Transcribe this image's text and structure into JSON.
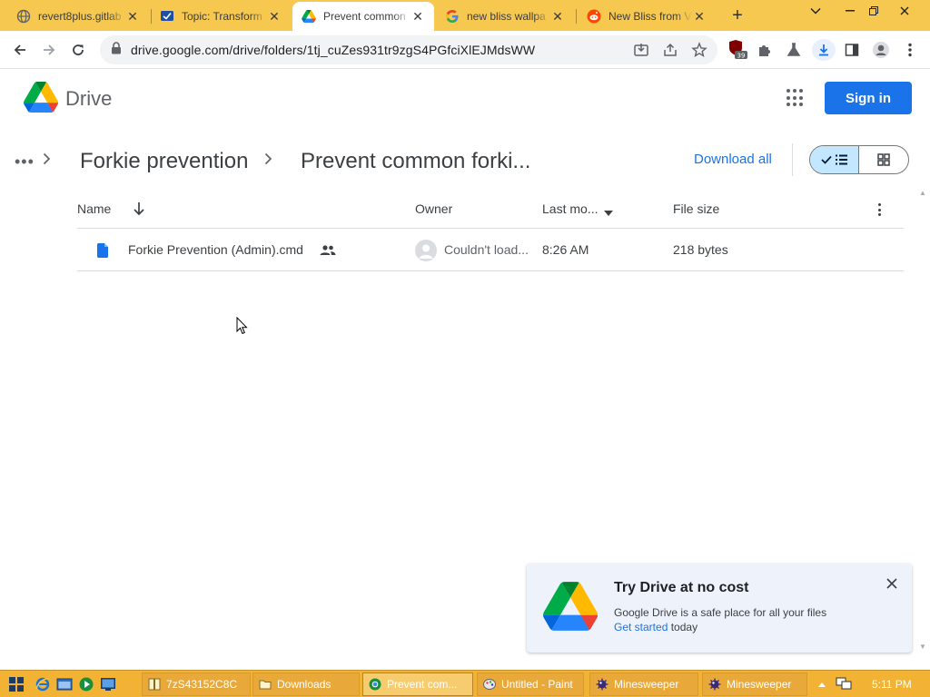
{
  "browser": {
    "tabs": [
      {
        "title": "revert8plus.gitlab",
        "icon": "globe-icon"
      },
      {
        "title": "Topic: Transform",
        "icon": "forum-icon"
      },
      {
        "title": "Prevent common",
        "icon": "drive-icon",
        "active": true
      },
      {
        "title": "new bliss wallpa",
        "icon": "google-icon"
      },
      {
        "title": "New Bliss from V",
        "icon": "reddit-icon"
      }
    ],
    "url": "drive.google.com/drive/folders/1tj_cuZes931tr9zgS4PGfciXlEJMdsWW",
    "extension_badge": "39"
  },
  "drive": {
    "title": "Drive",
    "sign_in": "Sign in",
    "breadcrumb": {
      "more": "•••",
      "parent": "Forkie prevention",
      "current": "Prevent common forki..."
    },
    "download_all": "Download all",
    "columns": {
      "name": "Name",
      "owner": "Owner",
      "last_modified": "Last mo...",
      "file_size": "File size"
    },
    "files": [
      {
        "name": "Forkie Prevention (Admin).cmd",
        "owner": "Couldn't load...",
        "last_modified": "8:26 AM",
        "size": "218 bytes",
        "shared": true
      }
    ],
    "promo": {
      "title": "Try Drive at no cost",
      "description": "Google Drive is a safe place for all your files",
      "cta": "Get started",
      "cta_suffix": " today"
    }
  },
  "taskbar": {
    "buttons": [
      {
        "label": "7zS43152C8C"
      },
      {
        "label": "Downloads"
      },
      {
        "label": "Prevent com...",
        "active": true
      },
      {
        "label": "Untitled - Paint"
      },
      {
        "label": "Minesweeper"
      },
      {
        "label": "Minesweeper"
      }
    ],
    "clock": "5:11 PM"
  },
  "colors": {
    "tabstrip": "#f6c84f",
    "accent": "#1a73e8",
    "taskbar": "#f2b233"
  }
}
